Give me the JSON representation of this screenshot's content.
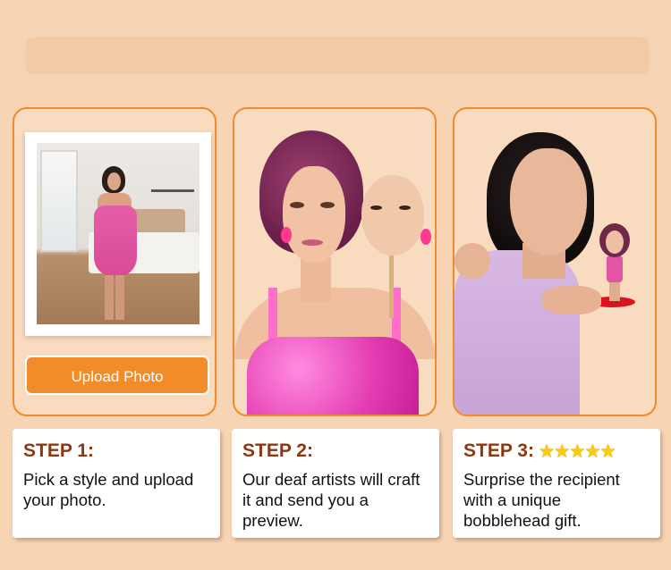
{
  "upload": {
    "label": "Upload Photo"
  },
  "steps": [
    {
      "title": "STEP 1:",
      "text": "Pick a style and upload your photo."
    },
    {
      "title": "STEP 2:",
      "text": "Our deaf artists will craft it and send you a preview."
    },
    {
      "title": "STEP 3:",
      "text": "Surprise the recipient with a unique bobblehead gift.",
      "rating": "★★★★★"
    }
  ],
  "colors": {
    "accent": "#f28c28",
    "background": "#f7d5b4",
    "step_title": "#8b3813"
  }
}
